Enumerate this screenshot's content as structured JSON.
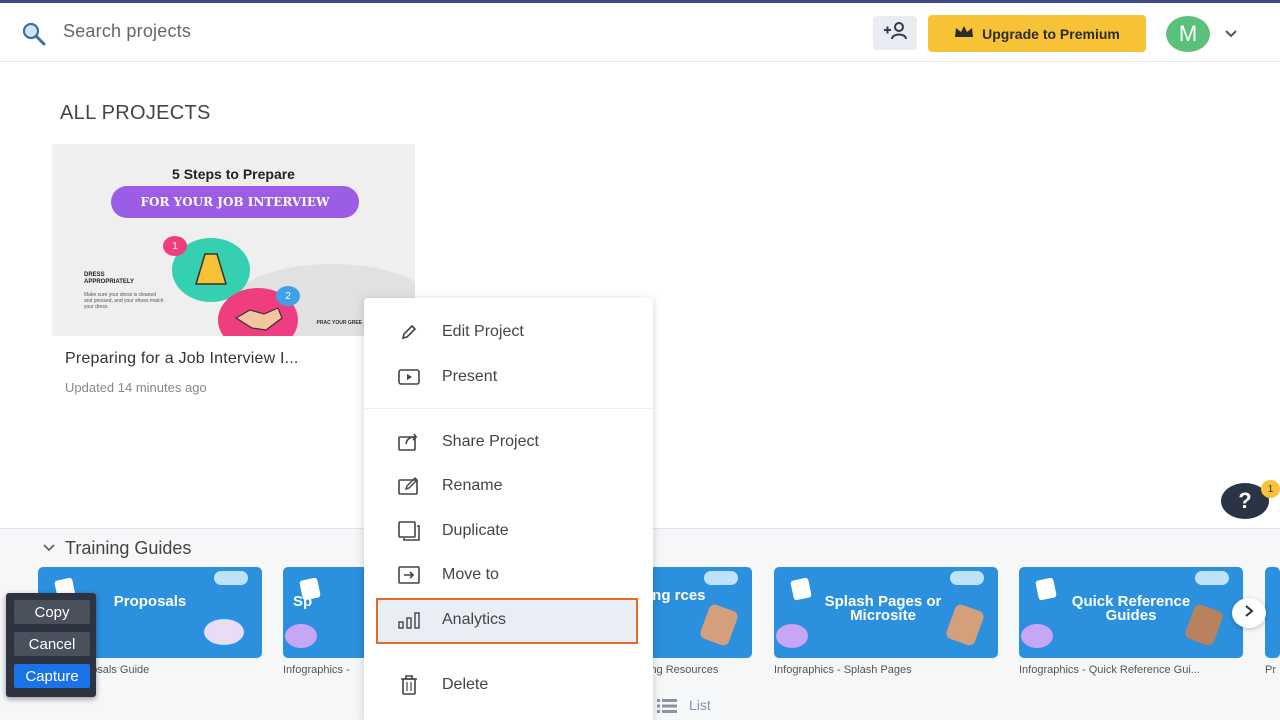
{
  "header": {
    "search_placeholder": "Search projects",
    "upgrade_label": "Upgrade to Premium",
    "avatar_initial": "M"
  },
  "section_title": "ALL PROJECTS",
  "project": {
    "thumb_title": "5 Steps to Prepare",
    "thumb_pill": "FOR YOUR JOB INTERVIEW",
    "thumb_step1": "DRESS APPROPRIATELY",
    "thumb_step1_text": "Make sure your dress is cleaned and pressed, and your shoes match your dress.",
    "thumb_corner": "PRAC YOUR GREE",
    "badge1": "1",
    "badge2": "2",
    "name": "Preparing for a Job Interview I...",
    "updated": "Updated 14 minutes ago"
  },
  "context_menu": {
    "items": [
      {
        "label": "Edit Project",
        "icon": "pencil-icon"
      },
      {
        "label": "Present",
        "icon": "play-icon"
      },
      {
        "label": "Share Project",
        "icon": "share-icon"
      },
      {
        "label": "Rename",
        "icon": "rename-icon"
      },
      {
        "label": "Duplicate",
        "icon": "duplicate-icon"
      },
      {
        "label": "Move to",
        "icon": "move-icon"
      },
      {
        "label": "Analytics",
        "icon": "analytics-icon"
      },
      {
        "label": "Delete",
        "icon": "trash-icon"
      }
    ],
    "highlighted": "Analytics"
  },
  "help": {
    "label": "?",
    "badge": "1"
  },
  "training": {
    "title": "Training Guides",
    "tiles": [
      {
        "text": "Proposals",
        "label": "ions - Proposals Guide"
      },
      {
        "text": "Sp",
        "label": "Infographics -"
      },
      {
        "text": "ing rces",
        "label": "ing Resources"
      },
      {
        "text": "Splash Pages or Microsite",
        "label": "Infographics - Splash Pages"
      },
      {
        "text": "Quick Reference Guides",
        "label": "Infographics - Quick Reference Gui..."
      },
      {
        "text": "",
        "label": "Pr"
      }
    ],
    "list_label": "List"
  },
  "capture_panel": {
    "copy": "Copy",
    "cancel": "Cancel",
    "capture": "Capture"
  },
  "colors": {
    "accent": "#f7c235",
    "tile_blue": "#2b90de",
    "highlight_border": "#e46a27",
    "avatar_green": "#5ac17a"
  }
}
